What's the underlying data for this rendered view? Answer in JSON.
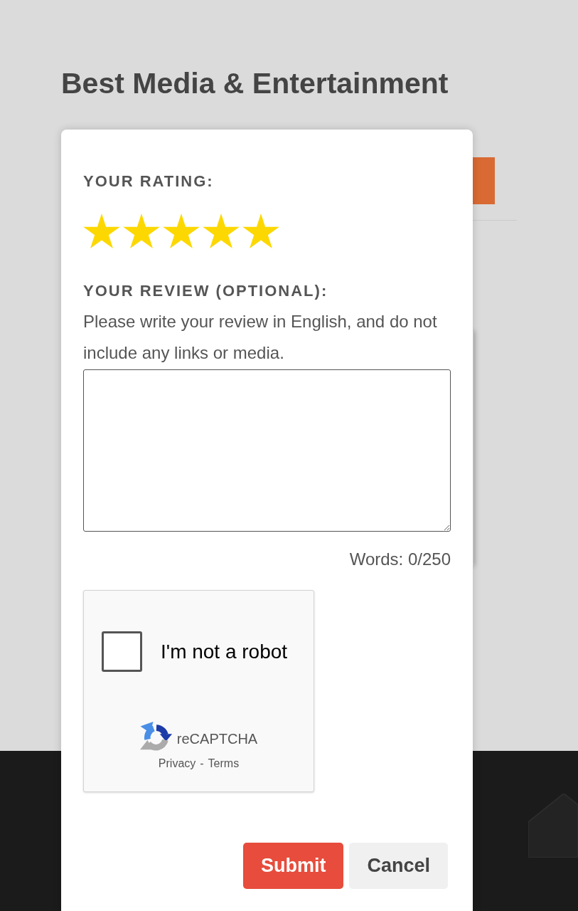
{
  "page": {
    "heading": "Best Media & Entertainment"
  },
  "dialog": {
    "rating_label": "YOUR RATING:",
    "rating": {
      "stars": 5
    },
    "review_label": "YOUR REVIEW (OPTIONAL):",
    "review_hint": "Please write your review in English, and do not include any links or media.",
    "word_count": "Words: 0/250",
    "captcha": {
      "checked": false,
      "label": "I'm not a robot",
      "brand": "reCAPTCHA",
      "links": [
        "Privacy",
        "Terms"
      ],
      "separator": "-"
    },
    "buttons": [
      {
        "label": "Submit",
        "kind": "primary"
      },
      {
        "label": "Cancel",
        "kind": "secondary"
      }
    ]
  }
}
